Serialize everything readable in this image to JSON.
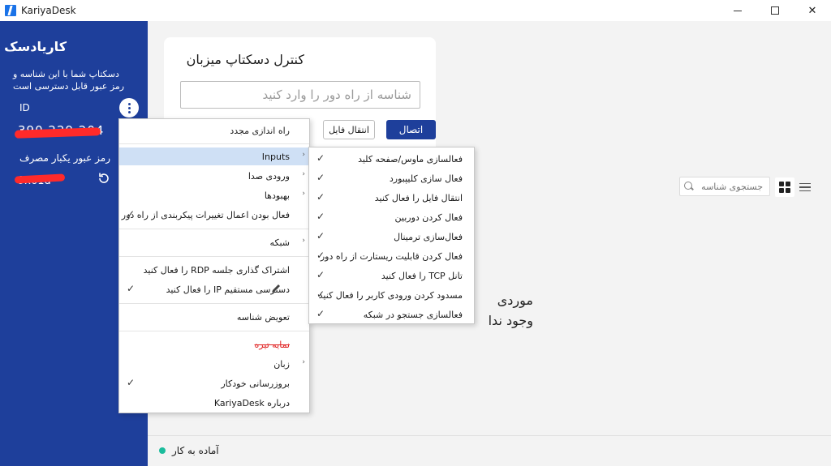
{
  "window": {
    "title": "KariyaDesk",
    "controls": {
      "minimize": "minimize-icon",
      "maximize": "maximize-icon",
      "close": "✕"
    }
  },
  "left_panel": {
    "title": "کاریادسک",
    "description": "دسکتاپ شما با این شناسه و رمز عبور قابل دسترسی است",
    "id_label": "ID",
    "id_value": "390 229 204",
    "password_label": "رمز عبور یکبار مصرف",
    "password_value": "9x61d"
  },
  "control_card": {
    "title": "کنترل دسکتاپ میزبان",
    "input_placeholder": "شناسه از راه دور را وارد کنید",
    "connect_label": "اتصال",
    "transfer_label": "انتقال فایل"
  },
  "search": {
    "placeholder": "جستجوی شناسه"
  },
  "empty_state": {
    "line1": "موردی",
    "line2": "وجود ندا"
  },
  "status": {
    "text": "آماده به کار",
    "color": "#1abc9c"
  },
  "context_menu": {
    "items": [
      {
        "label": "راه اندازی مجدد"
      },
      {
        "label": "Inputs",
        "submenu": true,
        "highlighted": true
      },
      {
        "label": "ورودی صدا",
        "submenu": true
      },
      {
        "label": "بهبودها",
        "submenu": true
      },
      {
        "label": "فعال بودن اعمال تغییرات پیکربندی از راه دور",
        "checked": true
      },
      {
        "label": "شبکه",
        "submenu": true
      },
      {
        "label": "اشتراک گذاری جلسه RDP را فعال کنید"
      },
      {
        "label": "دسترسی مستقیم IP را فعال کنید",
        "checked": true
      },
      {
        "label": "تعویض شناسه"
      },
      {
        "label": "نمایه تیره"
      },
      {
        "label": "زبان",
        "submenu": true
      },
      {
        "label": "بروزرسانی خودکار",
        "checked": true
      },
      {
        "label": "درباره KariyaDesk"
      }
    ]
  },
  "inputs_submenu": {
    "items": [
      {
        "label": "فعالسازی ماوس/صفحه کلید",
        "checked": true
      },
      {
        "label": "فعال سازی کلیپبورد",
        "checked": true
      },
      {
        "label": "انتقال فایل را فعال کنید",
        "checked": true
      },
      {
        "label": "فعال کردن دوربین",
        "checked": true
      },
      {
        "label": "فعال‌سازی ترمینال",
        "checked": true
      },
      {
        "label": "فعال کردن قابلیت ریستارت از راه دور",
        "checked": true
      },
      {
        "label": "تانل TCP را فعال کنید",
        "checked": true
      },
      {
        "label": "مسدود کردن ورودی کاربر را فعال کنید",
        "checked": true
      },
      {
        "label": "فعالسازی جستجو در شبکه",
        "checked": true
      }
    ]
  },
  "colors": {
    "primary": "#1e3f9b",
    "highlight": "#cfe0f5",
    "redaction": "#ff2a2a"
  }
}
